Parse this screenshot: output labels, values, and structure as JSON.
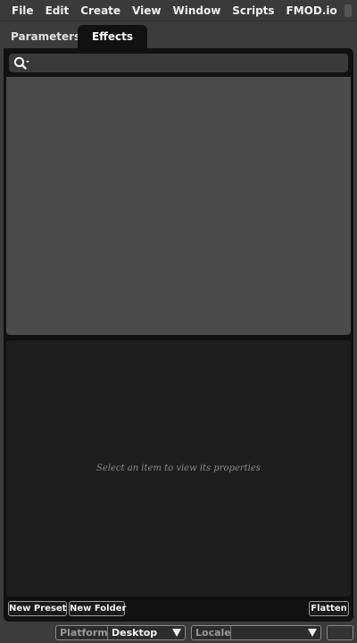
{
  "menu": {
    "file": "File",
    "edit": "Edit",
    "create": "Create",
    "view": "View",
    "window": "Window",
    "scripts": "Scripts",
    "fmodio": "FMOD.io"
  },
  "tabs": {
    "parameters": "Parameters",
    "effects": "Effects",
    "active": "Effects"
  },
  "search": {
    "icon": "search-icon",
    "value": "",
    "placeholder": ""
  },
  "properties": {
    "hint": "Select an item to view its properties"
  },
  "buttons": {
    "new_preset": "New Preset",
    "new_folder": "New Folder",
    "flatten": "Flatten"
  },
  "bottom": {
    "platform_label": "Platform",
    "platform_value": "Desktop",
    "locale_label": "Locale",
    "locale_value": ""
  },
  "colors": {
    "panel_bg": "#111111",
    "tree_bg": "#4b4b4b",
    "props_bg": "#1e1e1e",
    "chrome_bg": "#3c3c3c"
  }
}
